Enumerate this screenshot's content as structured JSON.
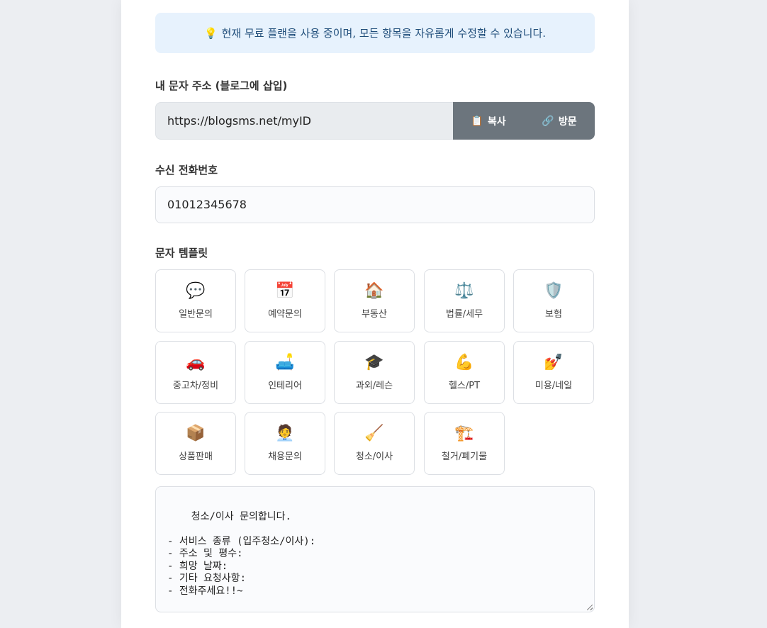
{
  "notice": {
    "icon": "lightbulb-icon",
    "text": "현재 무료 플랜을 사용 중이며, 모든 항목을 자유롭게 수정할 수 있습니다."
  },
  "address": {
    "label": "내 문자 주소 (블로그에 삽입)",
    "value": "https://blogsms.net/myID",
    "copy_label": "복사",
    "visit_label": "방문",
    "button_color": "#6c757d"
  },
  "phone": {
    "label": "수신 전화번호",
    "value": "01012345678"
  },
  "templates": {
    "label": "문자 템플릿",
    "items": [
      {
        "emoji": "💬",
        "name": "일반문의"
      },
      {
        "emoji": "📅",
        "name": "예약문의"
      },
      {
        "emoji": "🏠",
        "name": "부동산"
      },
      {
        "emoji": "⚖️",
        "name": "법률/세무"
      },
      {
        "emoji": "🛡️",
        "name": "보험"
      },
      {
        "emoji": "🚗",
        "name": "중고차/정비"
      },
      {
        "emoji": "🛋️",
        "name": "인테리어"
      },
      {
        "emoji": "🎓",
        "name": "과외/레슨"
      },
      {
        "emoji": "💪",
        "name": "헬스/PT"
      },
      {
        "emoji": "💅",
        "name": "미용/네일"
      },
      {
        "emoji": "📦",
        "name": "상품판매"
      },
      {
        "emoji": "🧑‍💼",
        "name": "채용문의"
      },
      {
        "emoji": "🧹",
        "name": "청소/이사"
      },
      {
        "emoji": "🏗️",
        "name": "철거/폐기물"
      }
    ]
  },
  "message": {
    "value": "청소/이사 문의합니다.\n\n- 서비스 종류 (입주청소/이사):\n- 주소 및 평수:\n- 희망 날짜:\n- 기타 요청사항:\n- 전화주세요!!~"
  },
  "colors": {
    "notice_bg": "#e7f2fd",
    "notice_text": "#1f4d7a"
  }
}
